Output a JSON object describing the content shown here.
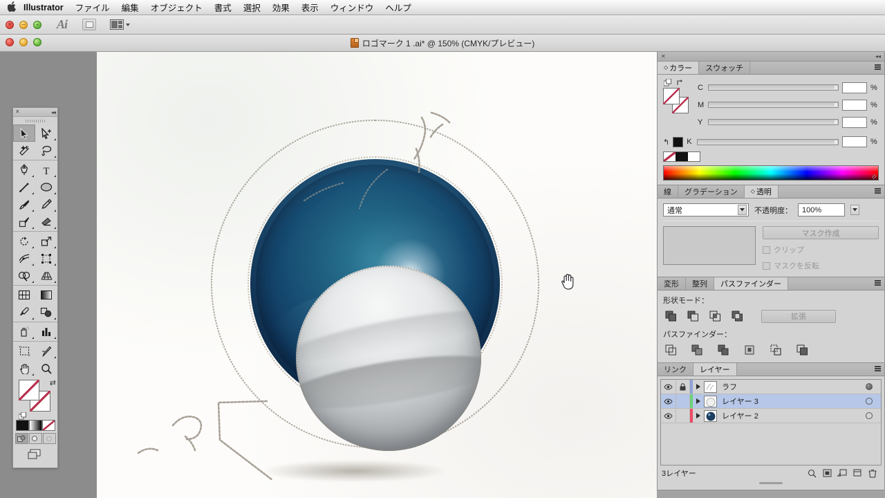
{
  "menubar": {
    "apple_icon": "apple-logo-icon",
    "app_name": "Illustrator",
    "items": [
      "ファイル",
      "編集",
      "オブジェクト",
      "書式",
      "選択",
      "効果",
      "表示",
      "ウィンドウ",
      "ヘルプ"
    ]
  },
  "appbar": {
    "logo": "Ai",
    "bridge_button": "bridge-icon",
    "arrange_button": "arrange-documents-icon"
  },
  "document": {
    "title": "ロゴマーク 1 .ai* @ 150% (CMYK/プレビュー)",
    "zoom": "150%",
    "color_mode": "CMYK",
    "view_mode": "プレビュー"
  },
  "toolbar": {
    "tools": [
      {
        "name": "selection-tool",
        "active": true
      },
      {
        "name": "direct-selection-tool",
        "active": false
      },
      {
        "name": "magic-wand-tool",
        "active": false
      },
      {
        "name": "lasso-tool",
        "active": false
      },
      {
        "name": "pen-tool",
        "active": false
      },
      {
        "name": "type-tool",
        "active": false
      },
      {
        "name": "line-segment-tool",
        "active": false
      },
      {
        "name": "ellipse-tool",
        "active": false
      },
      {
        "name": "paintbrush-tool",
        "active": false
      },
      {
        "name": "pencil-tool",
        "active": false
      },
      {
        "name": "blob-brush-tool",
        "active": false
      },
      {
        "name": "eraser-tool",
        "active": false
      },
      {
        "name": "rotate-tool",
        "active": false
      },
      {
        "name": "scale-tool",
        "active": false
      },
      {
        "name": "width-tool",
        "active": false
      },
      {
        "name": "free-transform-tool",
        "active": false
      },
      {
        "name": "shape-builder-tool",
        "active": false
      },
      {
        "name": "perspective-grid-tool",
        "active": false
      },
      {
        "name": "mesh-tool",
        "active": false
      },
      {
        "name": "gradient-tool",
        "active": false
      },
      {
        "name": "eyedropper-tool",
        "active": false
      },
      {
        "name": "blend-tool",
        "active": false
      },
      {
        "name": "symbol-sprayer-tool",
        "active": false
      },
      {
        "name": "column-graph-tool",
        "active": false
      },
      {
        "name": "artboard-tool",
        "active": false
      },
      {
        "name": "slice-tool",
        "active": false
      },
      {
        "name": "hand-tool",
        "active": false
      },
      {
        "name": "zoom-tool",
        "active": false
      }
    ],
    "fill": "none",
    "stroke": "none",
    "color_modes": [
      "color",
      "gradient",
      "none"
    ],
    "draw_modes": [
      "draw-normal",
      "draw-behind",
      "draw-inside"
    ],
    "screen_mode": "change-screen-mode-icon"
  },
  "color_panel": {
    "tabs": [
      {
        "label": "カラー",
        "active": true
      },
      {
        "label": "スウォッチ",
        "active": false
      }
    ],
    "sliders": [
      {
        "label": "C",
        "value": "",
        "unit": "%"
      },
      {
        "label": "M",
        "value": "",
        "unit": "%"
      },
      {
        "label": "Y",
        "value": "",
        "unit": "%"
      },
      {
        "label": "K",
        "value": "",
        "unit": "%"
      }
    ],
    "fill": "none",
    "stroke": "none",
    "quick_swatches": [
      "none",
      "black",
      "white"
    ]
  },
  "transparency_panel": {
    "tabs": [
      {
        "label": "線",
        "active": false
      },
      {
        "label": "グラデーション",
        "active": false
      },
      {
        "label": "透明",
        "active": true
      }
    ],
    "blend_mode": "通常",
    "opacity_label": "不透明度：",
    "opacity_value": "100%",
    "make_mask_button": "マスク作成",
    "clip_checkbox": "クリップ",
    "invert_mask_checkbox": "マスクを反転"
  },
  "pathfinder_panel": {
    "tabs": [
      {
        "label": "変形",
        "active": false
      },
      {
        "label": "整列",
        "active": false
      },
      {
        "label": "パスファインダー",
        "active": true
      }
    ],
    "shape_modes_label": "形状モード：",
    "expand_button": "拡張",
    "pathfinders_label": "パスファインダー：",
    "shape_mode_icons": [
      "unite-icon",
      "minus-front-icon",
      "intersect-icon",
      "exclude-icon"
    ],
    "pathfinder_icons": [
      "divide-icon",
      "trim-icon",
      "merge-icon",
      "crop-icon",
      "outline-icon",
      "minus-back-icon"
    ]
  },
  "layers_panel": {
    "tabs": [
      {
        "label": "リンク",
        "active": false
      },
      {
        "label": "レイヤー",
        "active": true
      }
    ],
    "layers": [
      {
        "name": "ラフ",
        "visible": true,
        "locked": true,
        "color": "#8fa0d8",
        "selected": false,
        "thumb": "sketch",
        "target_filled": true
      },
      {
        "name": "レイヤー 3",
        "visible": true,
        "locked": false,
        "color": "#6ed07a",
        "selected": true,
        "thumb": "white-sphere",
        "target_filled": false
      },
      {
        "name": "レイヤー 2",
        "visible": true,
        "locked": false,
        "color": "#ef4b63",
        "selected": false,
        "thumb": "blue-sphere",
        "target_filled": false
      }
    ],
    "status": "3レイヤー",
    "footer_icons": [
      "locate-object-icon",
      "make-clipping-mask-icon",
      "create-sublayer-icon",
      "create-new-layer-icon",
      "delete-selection-icon"
    ]
  },
  "canvas": {
    "cursor": "hand-cursor",
    "artwork_description": "logo-sketch-orb"
  }
}
